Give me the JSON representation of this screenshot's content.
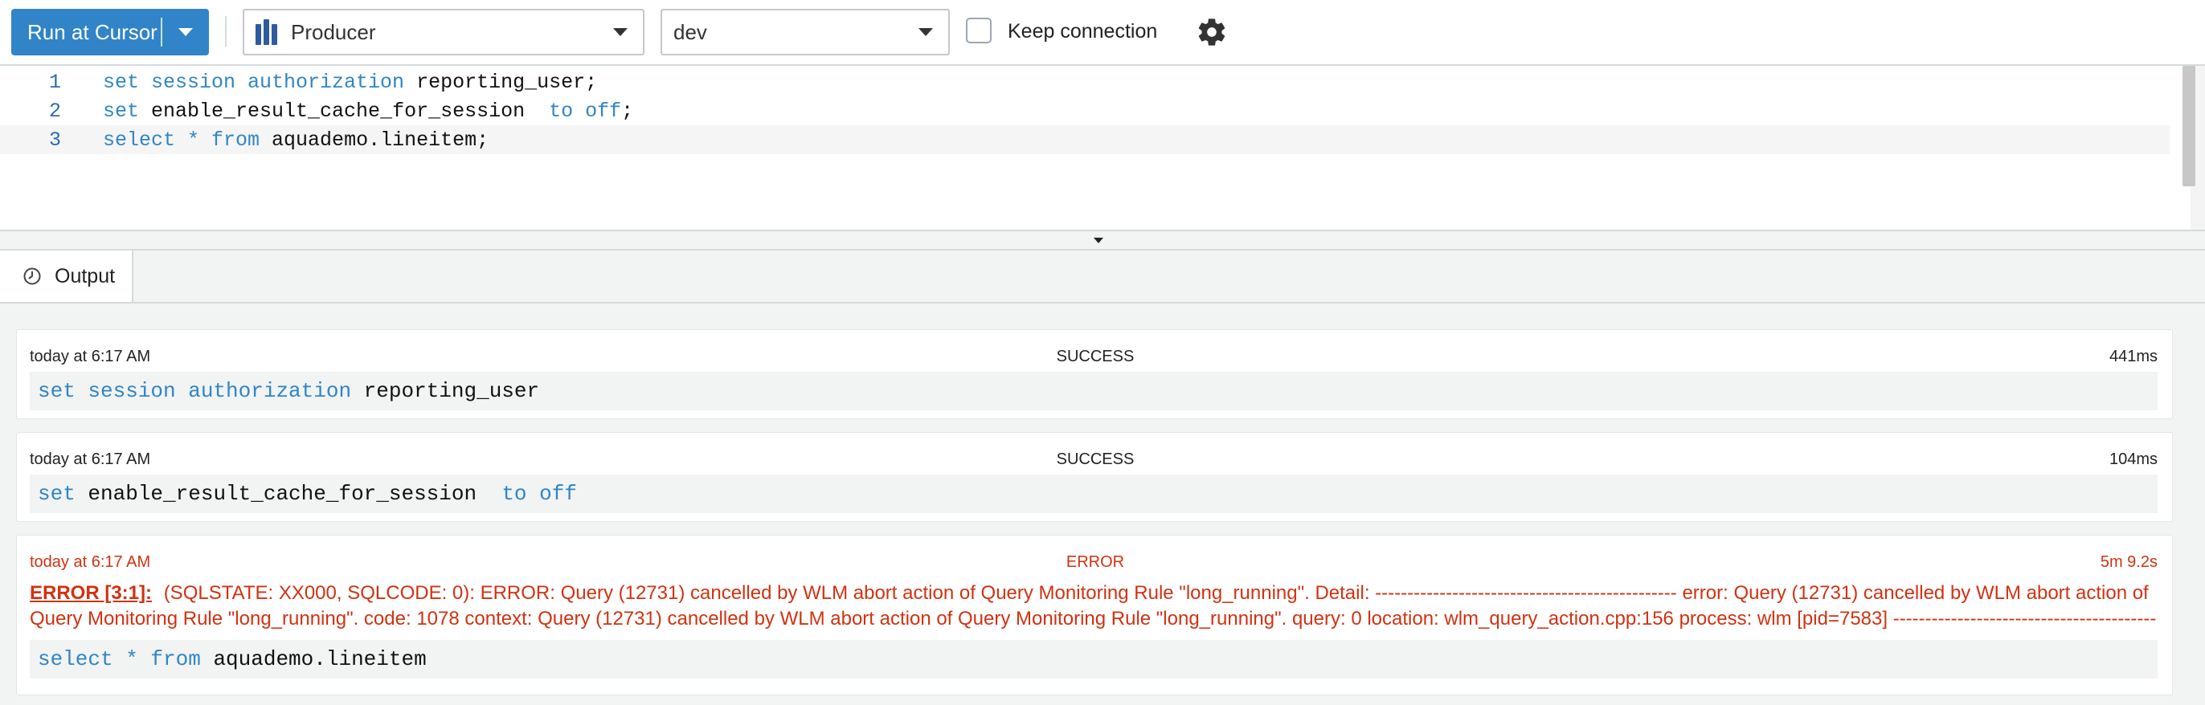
{
  "toolbar": {
    "run_label": "Run at Cursor",
    "cluster_select": "Producer",
    "database_select": "dev",
    "keep_connection_label": "Keep connection",
    "icons": {
      "cluster": "database-cluster-icon",
      "settings": "gear-icon",
      "dropdown": "chevron-down-icon"
    }
  },
  "editor": {
    "lines": [
      {
        "number": "1",
        "tokens": [
          {
            "t": "set session authorization",
            "k": "kw"
          },
          {
            "t": " reporting_user;",
            "k": "ident"
          }
        ]
      },
      {
        "number": "2",
        "tokens": [
          {
            "t": "set",
            "k": "kw"
          },
          {
            "t": " enable_result_cache_for_session  ",
            "k": "ident"
          },
          {
            "t": "to off",
            "k": "kw"
          },
          {
            "t": ";",
            "k": "ident"
          }
        ]
      },
      {
        "number": "3",
        "tokens": [
          {
            "t": "select * from",
            "k": "kw"
          },
          {
            "t": " aquademo.lineitem;",
            "k": "ident"
          }
        ]
      }
    ]
  },
  "output": {
    "tab_label": "Output",
    "results": [
      {
        "time": "today at 6:17 AM",
        "status": "SUCCESS",
        "duration": "441ms",
        "sql": [
          {
            "t": "set session authorization",
            "k": "kw"
          },
          {
            "t": " reporting_user",
            "k": "ident"
          }
        ]
      },
      {
        "time": "today at 6:17 AM",
        "status": "SUCCESS",
        "duration": "104ms",
        "sql": [
          {
            "t": "set",
            "k": "kw"
          },
          {
            "t": " enable_result_cache_for_session  ",
            "k": "ident"
          },
          {
            "t": "to off",
            "k": "kw"
          }
        ]
      },
      {
        "time": "today at 6:17 AM",
        "status": "ERROR",
        "duration": "5m 9.2s",
        "error_code": "ERROR [3:1]:",
        "error_message": "(SQLSTATE: XX000, SQLCODE: 0): ERROR: Query (12731) cancelled by WLM abort action of Query Monitoring Rule \"long_running\". Detail: ----------------------------------------------- error: Query (12731) cancelled by WLM abort action of Query Monitoring Rule \"long_running\". code: 1078 context: Query (12731) cancelled by WLM abort action of Query Monitoring Rule \"long_running\". query: 0 location: wlm_query_action.cpp:156 process: wlm [pid=7583] -----------------------------------------------",
        "sql": [
          {
            "t": "select * from",
            "k": "kw"
          },
          {
            "t": " aquademo.lineitem",
            "k": "ident"
          }
        ]
      }
    ]
  },
  "colors": {
    "accent": "#3184c8",
    "keyword": "#2f86c6",
    "error": "#d13212"
  }
}
